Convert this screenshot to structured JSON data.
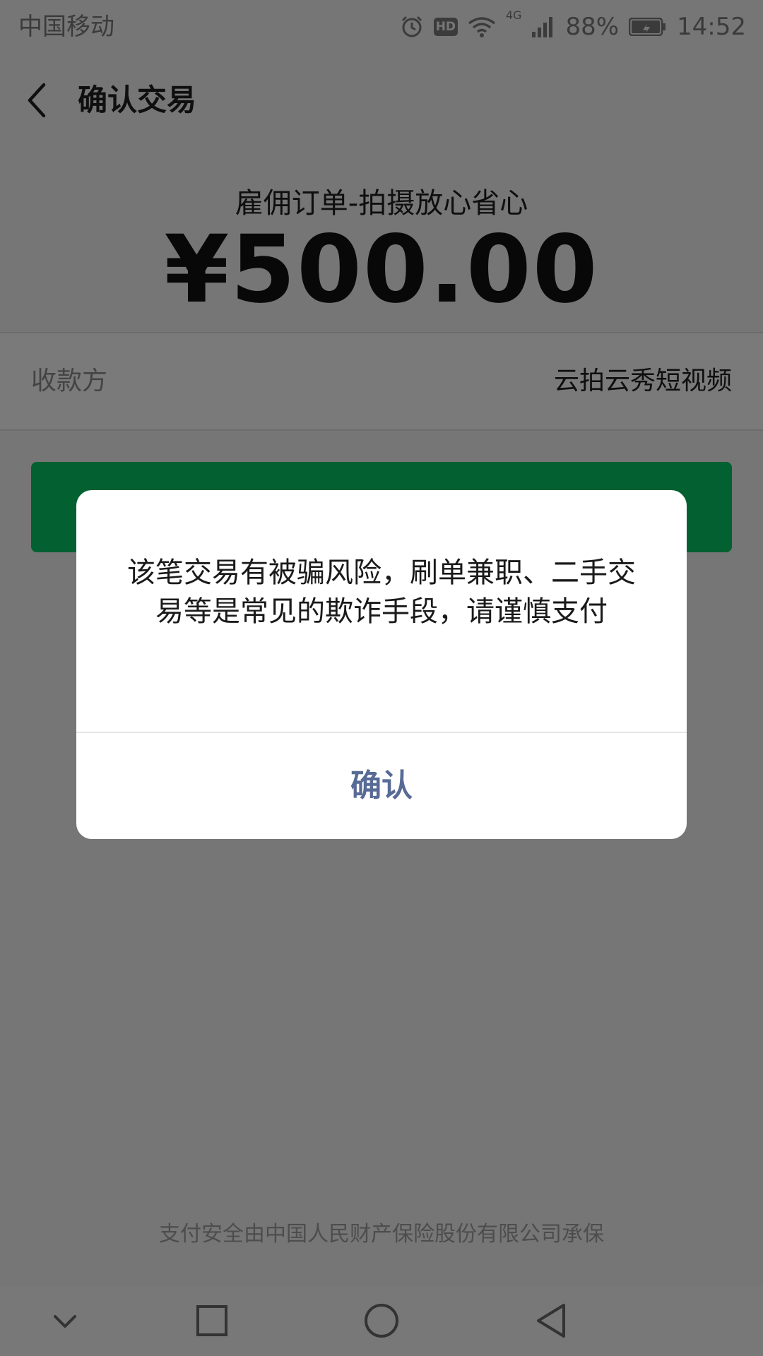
{
  "status_bar": {
    "carrier": "中国移动",
    "hd": "HD",
    "network": "4G",
    "battery": "88%",
    "time": "14:52",
    "icons": [
      "alarm-icon",
      "hd-icon",
      "wifi-icon",
      "signal-icon",
      "battery-icon"
    ]
  },
  "nav": {
    "title": "确认交易",
    "back_icon": "chevron-left-icon"
  },
  "order": {
    "name": "雇佣订单-拍摄放心省心",
    "amount": "¥500.00"
  },
  "payee": {
    "label": "收款方",
    "value": "云拍云秀短视频"
  },
  "dialog": {
    "message": "该笔交易有被骗风险，刷单兼职、二手交易等是常见的欺诈手段，请谨慎支付",
    "confirm_label": "确认"
  },
  "footer": {
    "security_note": "支付安全由中国人民财产保险股份有限公司承保"
  },
  "colors": {
    "pay_button": "#07c160",
    "dialog_link": "#576b95"
  },
  "android_nav": [
    "chevron-down-icon",
    "recent-apps-icon",
    "home-icon",
    "back-triangle-icon"
  ]
}
